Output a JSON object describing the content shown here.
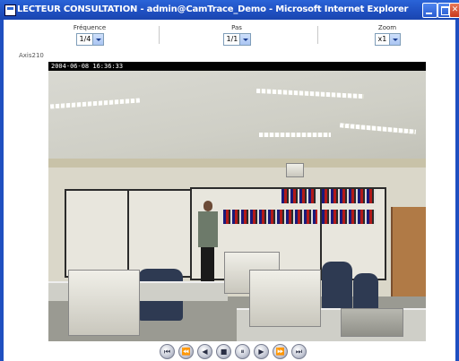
{
  "window": {
    "title": "LECTEUR CONSULTATION - admin@CamTrace_Demo - Microsoft Internet Explorer"
  },
  "controls": {
    "frequence": {
      "label": "Fréquence",
      "value": "1/4"
    },
    "pas": {
      "label": "Pas",
      "value": "1/1"
    },
    "zoom": {
      "label": "Zoom",
      "value": "x1"
    }
  },
  "camera": {
    "name": "Axis210",
    "timestamp": "2004-06-08 16:36:33"
  },
  "transport": {
    "buttons": [
      {
        "name": "first",
        "glyph": "⏮"
      },
      {
        "name": "fast-rewind",
        "glyph": "⏪"
      },
      {
        "name": "step-back",
        "glyph": "◀"
      },
      {
        "name": "stop",
        "glyph": "■"
      },
      {
        "name": "pause",
        "glyph": "⏸"
      },
      {
        "name": "play",
        "glyph": "▶"
      },
      {
        "name": "fast-forward",
        "glyph": "⏩"
      },
      {
        "name": "last",
        "glyph": "⏭"
      }
    ]
  }
}
